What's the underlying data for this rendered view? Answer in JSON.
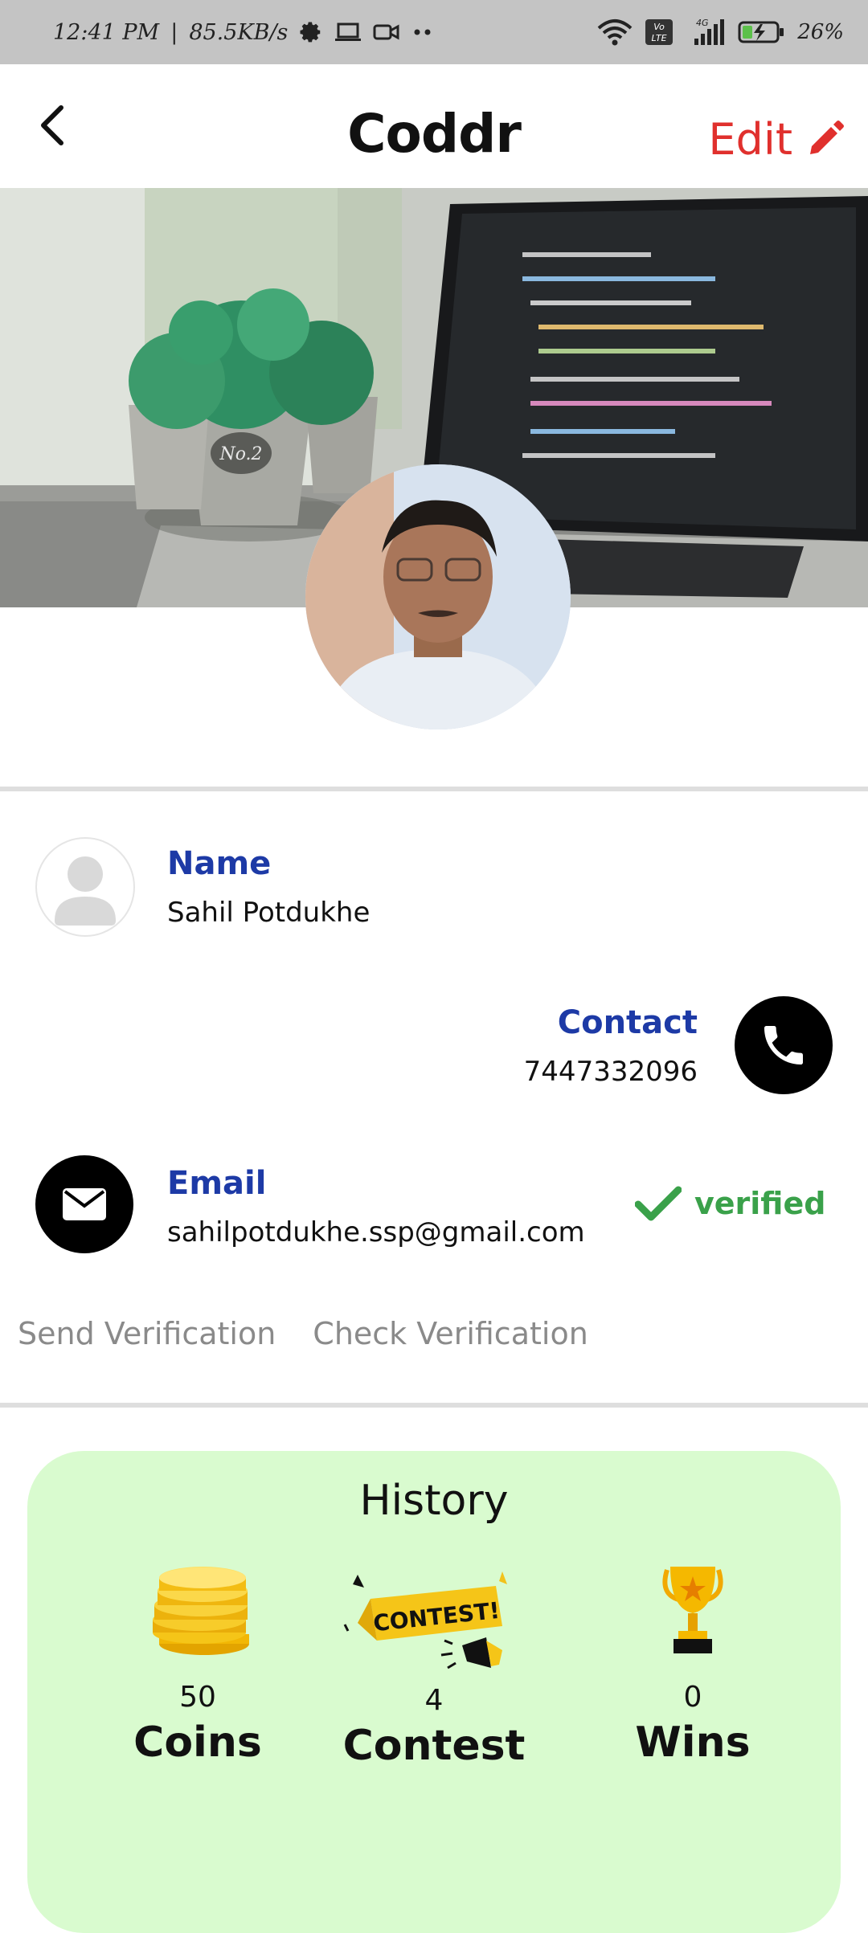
{
  "status_bar": {
    "time": "12:41 PM",
    "speed": "85.5KB/s",
    "network": "4G",
    "volte": "Vo LTE",
    "battery": "26%"
  },
  "app_bar": {
    "title": "Coddr",
    "edit_label": "Edit",
    "icons": {
      "back": "back-arrow-icon",
      "edit": "pencil-icon"
    }
  },
  "profile": {
    "cover_image": "laptop-with-plants-photo",
    "avatar_image": "profile-photo"
  },
  "details": {
    "name_label": "Name",
    "name_value": "Sahil Potdukhe",
    "contact_label": "Contact",
    "contact_value": "7447332096",
    "email_label": "Email",
    "email_value": "sahilpotdukhe.ssp@gmail.com",
    "verified_label": "verified",
    "send_verification": "Send Verification",
    "check_verification": "Check Verification"
  },
  "history": {
    "title": "History",
    "stats": [
      {
        "count": "50",
        "label": "Coins",
        "icon": "coins-icon"
      },
      {
        "count": "4",
        "label": "Contest",
        "icon": "contest-banner-icon",
        "banner_text": "CONTEST!"
      },
      {
        "count": "0",
        "label": "Wins",
        "icon": "trophy-icon"
      }
    ]
  },
  "colors": {
    "accent_edit": "#e0302d",
    "label_blue": "#1d3aa6",
    "verified_green": "#3aa14a",
    "history_bg": "#d9fbcf",
    "status_bar_bg": "#c4c4c4"
  }
}
